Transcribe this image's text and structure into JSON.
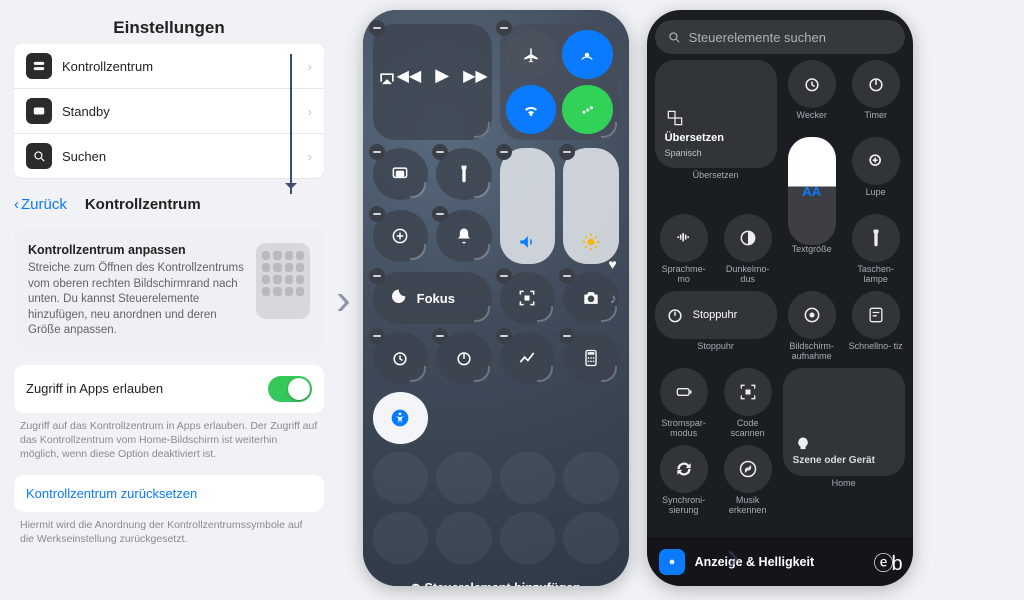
{
  "settings": {
    "title": "Einstellungen",
    "rows": [
      {
        "label": "Kontrollzentrum"
      },
      {
        "label": "Standby"
      },
      {
        "label": "Suchen"
      }
    ],
    "back": "Zurück",
    "page_title": "Kontrollzentrum",
    "info": {
      "heading": "Kontrollzentrum anpassen",
      "body": "Streiche zum Öffnen des Kontrollzentrums vom oberen rechten Bildschirmrand nach unten. Du kannst Steuerelemente hinzufügen, neu anordnen und deren Größe anpassen."
    },
    "switch_label": "Zugriff in Apps erlauben",
    "switch_foot": "Zugriff auf das Kontrollzentrum in Apps erlauben. Der Zugriff auf das Kontrollzentrum vom Home-Bildschirm ist weiterhin möglich, wenn diese Option deaktiviert ist.",
    "reset_label": "Kontrollzentrum zurücksetzen",
    "reset_foot": "Hiermit wird die Anordnung der Kontrollzentrumssymbole auf die Werkseinstellung zurückgesetzt."
  },
  "cc_edit": {
    "focus": "Fokus",
    "add_control": "Steuerelement hinzufügen"
  },
  "gallery": {
    "search_placeholder": "Steuerelemente suchen",
    "translate_title": "Übersetzen",
    "translate_lang": "Spanisch",
    "items": {
      "wecker": "Wecker",
      "timer": "Timer",
      "ubersetzen": "Übersetzen",
      "lupe": "Lupe",
      "sprachmemo": "Sprachme-\nmo",
      "dunkelmodus": "Dunkelmo-\ndus",
      "textgroesse": "Textgröße",
      "taschenlampe": "Taschen-\nlampe",
      "stoppuhr_pill": "Stoppuhr",
      "stoppuhr": "Stoppuhr",
      "bildschirmaufnahme": "Bildschirm-\naufnahme",
      "schnellnotiz": "Schnellno-\ntiz",
      "stromsparmodus": "Stromspar-\nmodus",
      "codescannen": "Code\nscannen",
      "synchronisierung": "Synchroni-\nsierung",
      "musikerkennen": "Musik\nerkennen",
      "szene": "Szene oder Gerät",
      "home": "Home"
    },
    "footer": "Anzeige & Helligkeit"
  }
}
